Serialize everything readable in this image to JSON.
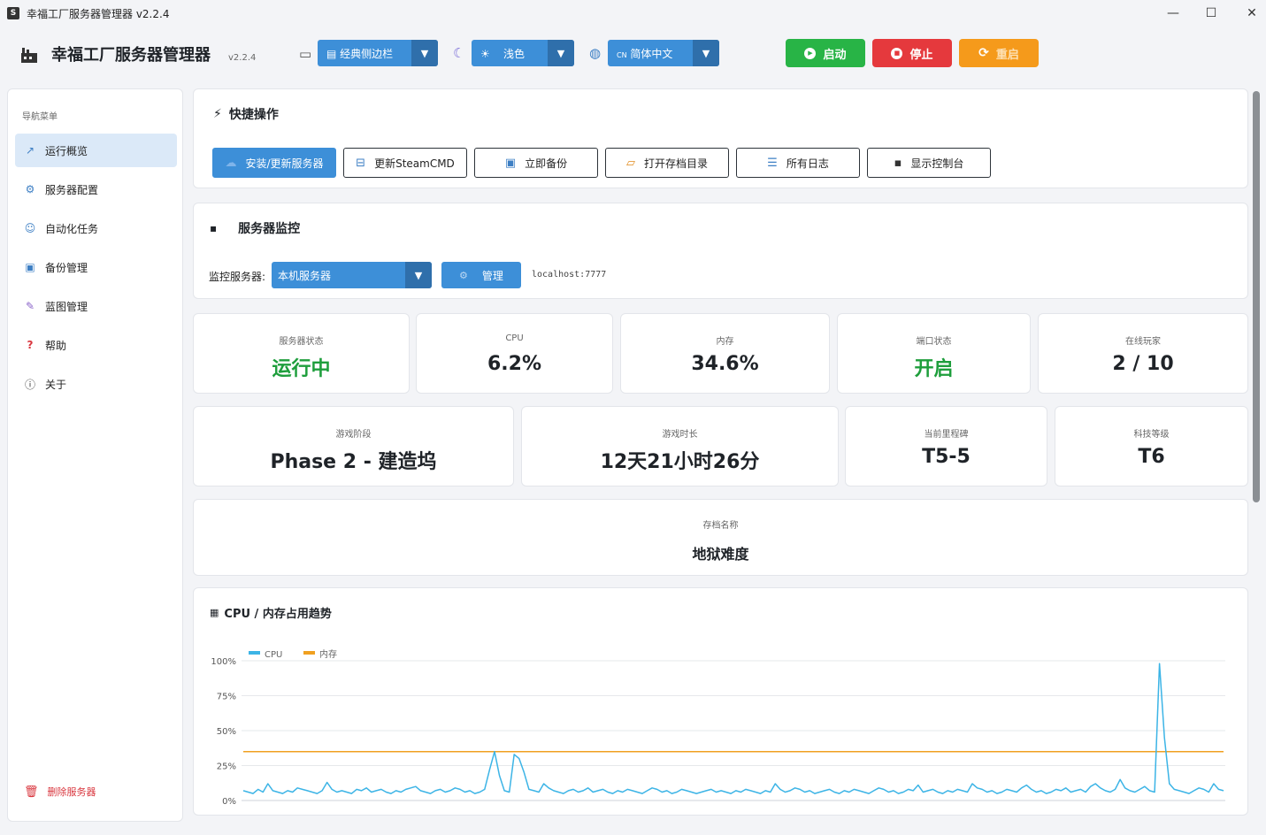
{
  "window": {
    "title": "幸福工厂服务器管理器 v2.2.4",
    "controls": {
      "minimize": "—",
      "maximize": "☐",
      "close": "✕"
    }
  },
  "header": {
    "brand": "幸福工厂服务器管理器",
    "version": "v2.2.4",
    "layout_select": {
      "icon": "▤",
      "value": "经典侧边栏"
    },
    "theme_select": {
      "icon": "☀",
      "value": "浅色"
    },
    "lang_select": {
      "icon": "CN",
      "value": "简体中文"
    },
    "start_label": "启动",
    "stop_label": "停止",
    "restart_label": "重启",
    "colors": {
      "start": "#28b446",
      "stop": "#e5393d",
      "restart": "#f59a1b"
    }
  },
  "sidebar": {
    "caption": "导航菜单",
    "items": [
      {
        "label": "运行概览",
        "icon": "chart-icon"
      },
      {
        "label": "服务器配置",
        "icon": "gear-icon"
      },
      {
        "label": "自动化任务",
        "icon": "user-icon"
      },
      {
        "label": "备份管理",
        "icon": "save-icon"
      },
      {
        "label": "蓝图管理",
        "icon": "wrench-icon"
      },
      {
        "label": "帮助",
        "icon": "question-icon"
      },
      {
        "label": "关于",
        "icon": "info-icon"
      }
    ],
    "delete_label": "删除服务器"
  },
  "quick_actions": {
    "title": "快捷操作",
    "buttons": [
      "安装/更新服务器",
      "更新SteamCMD",
      "立即备份",
      "打开存档目录",
      "所有日志",
      "显示控制台"
    ]
  },
  "monitor": {
    "title": "服务器监控",
    "server_label": "监控服务器:",
    "server_value": "本机服务器",
    "manage_label": "管理",
    "address": "localhost:7777"
  },
  "stats_row1": [
    {
      "label": "服务器状态",
      "value": "运行中"
    },
    {
      "label": "CPU",
      "value": "6.2%"
    },
    {
      "label": "内存",
      "value": "34.6%"
    },
    {
      "label": "端口状态",
      "value": "开启"
    },
    {
      "label": "在线玩家",
      "value": "2 / 10"
    }
  ],
  "stats_row2": [
    {
      "label": "游戏阶段",
      "value": "Phase 2 - 建造坞"
    },
    {
      "label": "游戏时长",
      "value": "12天21小时26分"
    },
    {
      "label": "当前里程碑",
      "value": "T5-5"
    },
    {
      "label": "科技等级",
      "value": "T6"
    }
  ],
  "save": {
    "label": "存档名称",
    "value": "地狱难度"
  },
  "chart_data": {
    "type": "line",
    "title": "CPU / 内存占用趋势",
    "xlabel": "",
    "ylabel": "",
    "ylim": [
      0,
      100
    ],
    "yticks": [
      "0%",
      "25%",
      "50%",
      "75%",
      "100%"
    ],
    "legend_position": "top-left",
    "grid": true,
    "series": [
      {
        "name": "CPU",
        "color": "#3cb4e6",
        "values": [
          7,
          6,
          5,
          8,
          6,
          12,
          7,
          6,
          5,
          7,
          6,
          9,
          8,
          7,
          6,
          5,
          7,
          13,
          8,
          6,
          7,
          6,
          5,
          8,
          7,
          9,
          6,
          7,
          8,
          6,
          5,
          7,
          6,
          8,
          9,
          10,
          7,
          6,
          5,
          7,
          8,
          6,
          7,
          9,
          8,
          6,
          7,
          5,
          6,
          8,
          22,
          35,
          18,
          7,
          6,
          33,
          30,
          20,
          8,
          7,
          6,
          12,
          9,
          7,
          6,
          5,
          7,
          8,
          6,
          7,
          9,
          6,
          7,
          8,
          6,
          5,
          7,
          6,
          8,
          7,
          6,
          5,
          7,
          9,
          8,
          6,
          7,
          5,
          6,
          8,
          7,
          6,
          5,
          6,
          7,
          8,
          6,
          7,
          6,
          5,
          7,
          6,
          8,
          7,
          6,
          5,
          7,
          6,
          12,
          8,
          6,
          7,
          9,
          8,
          6,
          7,
          5,
          6,
          7,
          8,
          6,
          5,
          7,
          6,
          8,
          7,
          6,
          5,
          7,
          9,
          8,
          6,
          7,
          5,
          6,
          8,
          7,
          11,
          6,
          7,
          8,
          6,
          5,
          7,
          6,
          8,
          7,
          6,
          12,
          9,
          8,
          6,
          7,
          5,
          6,
          8,
          7,
          6,
          9,
          11,
          8,
          6,
          7,
          5,
          6,
          8,
          7,
          9,
          6,
          7,
          8,
          6,
          10,
          12,
          9,
          7,
          6,
          8,
          15,
          9,
          7,
          6,
          8,
          10,
          7,
          6,
          98,
          45,
          12,
          8,
          7,
          6,
          5,
          7,
          9,
          8,
          6,
          12,
          8,
          7
        ],
        "note_visible": false
      },
      {
        "name": "内存",
        "color": "#f0a020",
        "values": [
          35,
          35,
          35,
          35,
          35,
          35,
          35,
          35,
          35,
          35,
          35,
          35,
          35,
          35,
          35,
          35,
          35,
          35,
          35,
          35,
          35,
          35,
          35,
          35,
          35,
          35,
          35,
          35,
          35,
          35,
          35,
          35,
          35,
          35,
          35,
          35,
          35,
          35,
          35,
          35,
          35,
          35,
          35,
          35,
          35,
          35,
          35,
          35,
          35,
          35,
          35,
          35,
          35,
          35,
          35,
          35,
          35,
          35,
          35,
          35,
          35,
          35,
          35,
          35,
          35,
          35,
          35,
          35,
          35,
          35,
          35,
          35,
          35,
          35,
          35,
          35,
          35,
          35,
          35,
          35,
          35,
          35,
          35,
          35,
          35,
          35,
          35,
          35,
          35,
          35,
          35,
          35,
          35,
          35,
          35,
          35,
          35,
          35,
          35,
          35,
          35,
          35,
          35,
          35,
          35,
          35,
          35,
          35,
          35,
          35,
          35,
          35,
          35,
          35,
          35,
          35,
          35,
          35,
          35,
          35,
          35,
          35,
          35,
          35,
          35,
          35,
          35,
          35,
          35,
          35,
          35,
          35,
          35,
          35,
          35,
          35,
          35,
          35,
          35,
          35,
          35,
          35,
          35,
          35,
          35,
          35,
          35,
          35,
          35,
          35,
          35,
          35,
          35,
          35,
          35,
          35,
          35,
          35,
          35,
          35,
          35,
          35,
          35,
          35,
          35,
          35,
          35,
          35,
          35,
          35,
          35,
          35,
          35,
          35,
          35,
          35,
          35,
          35,
          35,
          35,
          35,
          35,
          35,
          35,
          35,
          35,
          35,
          35,
          35,
          35,
          35,
          35,
          35,
          35,
          35,
          35,
          35,
          35
        ]
      }
    ]
  }
}
